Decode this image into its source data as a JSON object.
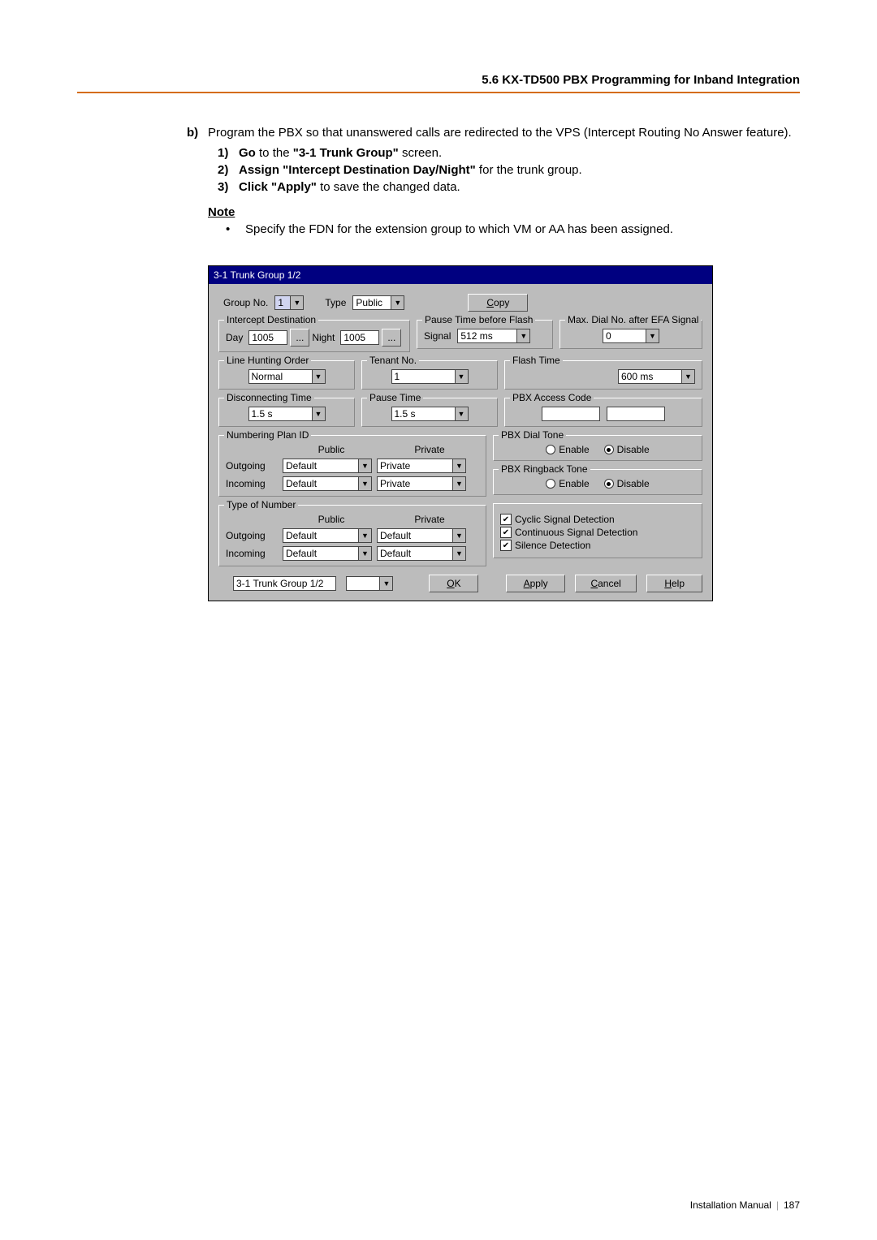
{
  "header": {
    "section_title": "5.6 KX-TD500 PBX Programming for Inband Integration"
  },
  "body": {
    "b_label": "b)",
    "b_text": "Program the PBX so that unanswered calls are redirected to the VPS (Intercept Routing No Answer feature).",
    "steps": [
      {
        "num": "1)",
        "pre_bold": "Go",
        "post": " to the ",
        "quoted_bold": "\"3-1 Trunk Group\"",
        "tail": " screen."
      },
      {
        "num": "2)",
        "pre_bold": "Assign \"Intercept Destination Day/Night\"",
        "tail": " for the trunk group."
      },
      {
        "num": "3)",
        "pre_bold": "Click \"Apply\"",
        "tail": " to save the changed data."
      }
    ],
    "note_label": "Note",
    "note_text": "Specify the FDN for the extension group to which VM or AA has been assigned."
  },
  "dialog": {
    "title": "3-1 Trunk Group 1/2",
    "group_no_label": "Group No.",
    "group_no_value": "1",
    "type_label": "Type",
    "type_value": "Public",
    "copy_btn": "Copy",
    "intercept": {
      "legend": "Intercept Destination",
      "day_label": "Day",
      "day_value": "1005",
      "night_label": "Night",
      "night_value": "1005"
    },
    "pause_flash": {
      "legend": "Pause Time before Flash",
      "signal_label": "Signal",
      "signal_value": "512 ms"
    },
    "max_dial": {
      "legend": "Max. Dial No. after EFA Signal",
      "value": "0"
    },
    "line_hunting": {
      "legend": "Line Hunting Order",
      "value": "Normal"
    },
    "tenant_no": {
      "legend": "Tenant No.",
      "value": "1"
    },
    "flash_time": {
      "legend": "Flash Time",
      "value": "600 ms"
    },
    "disc_time": {
      "legend": "Disconnecting Time",
      "value": "1.5 s"
    },
    "pause_time": {
      "legend": "Pause Time",
      "value": "1.5 s"
    },
    "pbx_access": {
      "legend": "PBX Access Code"
    },
    "numbering_plan": {
      "legend": "Numbering Plan ID",
      "public_hdr": "Public",
      "private_hdr": "Private",
      "outgoing": "Outgoing",
      "incoming": "Incoming",
      "out_public": "Default",
      "out_private": "Private",
      "in_public": "Default",
      "in_private": "Private"
    },
    "dial_tone": {
      "legend": "PBX Dial Tone",
      "enable": "Enable",
      "disable": "Disable",
      "value": "Disable"
    },
    "ringback": {
      "legend": "PBX Ringback Tone",
      "enable": "Enable",
      "disable": "Disable",
      "value": "Disable"
    },
    "type_of_number": {
      "legend": "Type of Number",
      "public_hdr": "Public",
      "private_hdr": "Private",
      "outgoing": "Outgoing",
      "incoming": "Incoming",
      "out_public": "Default",
      "out_private": "Default",
      "in_public": "Default",
      "in_private": "Default"
    },
    "signal_checks": {
      "cyclic": "Cyclic Signal Detection",
      "continuous": "Continuous Signal Detection",
      "silence": "Silence Detection"
    },
    "bottom": {
      "page_sel": "3-1 Trunk Group 1/2",
      "ok": "OK",
      "apply": "Apply",
      "cancel": "Cancel",
      "help": "Help"
    }
  },
  "footer": {
    "manual": "Installation Manual",
    "page": "187"
  }
}
